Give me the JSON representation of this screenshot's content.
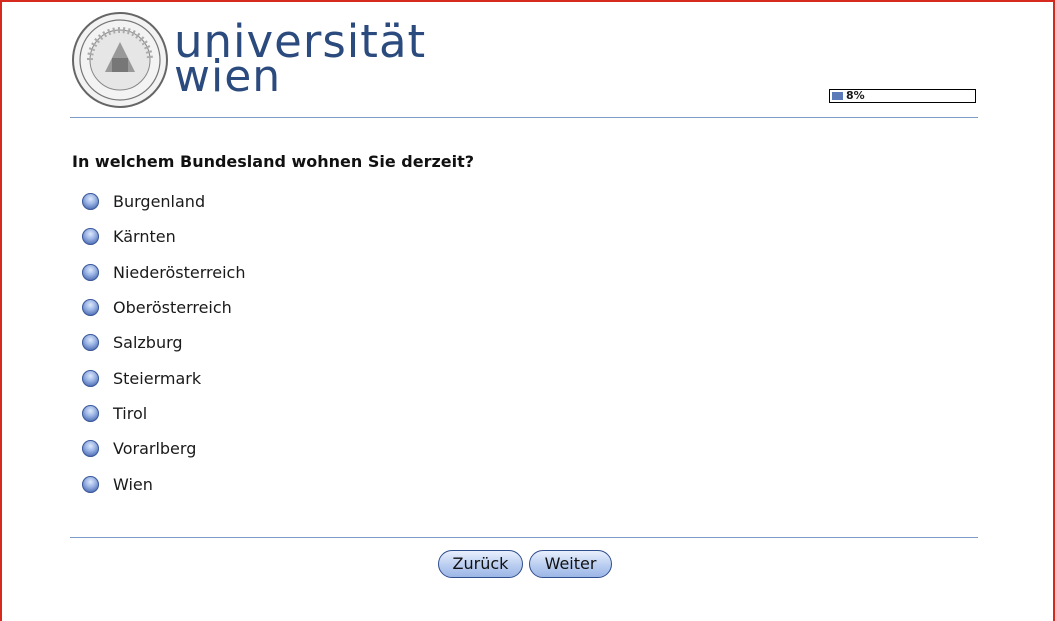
{
  "header": {
    "brand_line1": "universität",
    "brand_line2": "wien"
  },
  "progress": {
    "percent": 8,
    "label": "8%"
  },
  "question": {
    "text": "In welchem Bundesland wohnen Sie derzeit?",
    "options": [
      "Burgenland",
      "Kärnten",
      "Niederösterreich",
      "Oberösterreich",
      "Salzburg",
      "Steiermark",
      "Tirol",
      "Vorarlberg",
      "Wien"
    ]
  },
  "nav": {
    "back_label": "Zurück",
    "next_label": "Weiter"
  },
  "colors": {
    "brand": "#2b4a7d",
    "accent": "#5a7ab8",
    "frame": "#d62a1f"
  }
}
